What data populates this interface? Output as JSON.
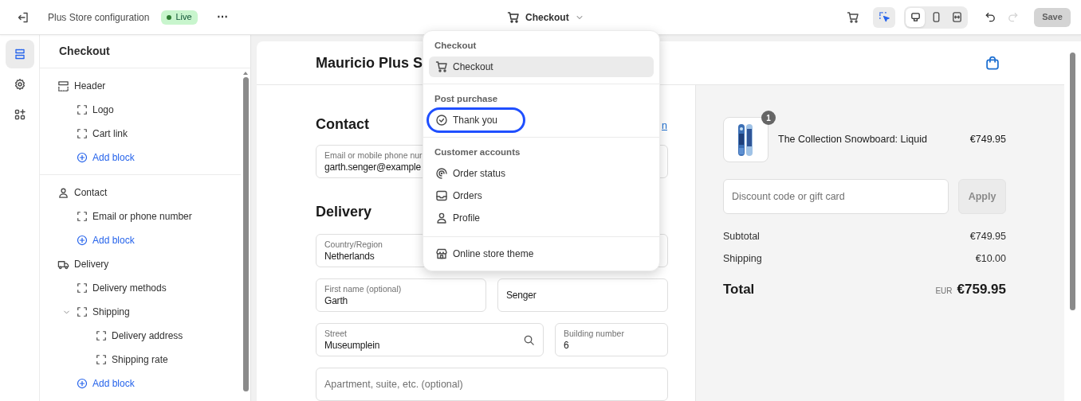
{
  "topbar": {
    "title": "Plus Store configuration",
    "status": {
      "label": "Live",
      "color": "#2e7d32"
    },
    "more": "⋯",
    "page_switcher": {
      "label": "Checkout",
      "expanded": true
    }
  },
  "toolbar": {
    "inspector_on": true,
    "views": [
      {
        "kind": "desktop",
        "selected": true
      },
      {
        "kind": "mobile",
        "selected": false
      },
      {
        "kind": "fullwidth",
        "selected": false
      }
    ],
    "undo_disabled": false,
    "redo_disabled": true,
    "save": {
      "label": "Save",
      "disabled": true
    }
  },
  "rail": [
    {
      "kind": "sections",
      "selected": true
    },
    {
      "kind": "settings",
      "selected": false
    },
    {
      "kind": "apps",
      "selected": false
    }
  ],
  "sidebar": {
    "title": "Checkout",
    "groups": [
      {
        "sections": [
          {
            "kind": "header",
            "label": "Header",
            "children": [
              {
                "kind": "block",
                "label": "Logo"
              },
              {
                "kind": "block",
                "label": "Cart link"
              },
              {
                "kind": "add",
                "label": "Add block"
              }
            ]
          }
        ]
      },
      {
        "sections": [
          {
            "kind": "contact",
            "label": "Contact",
            "children": [
              {
                "kind": "block",
                "label": "Email or phone number"
              },
              {
                "kind": "add",
                "label": "Add block"
              }
            ]
          },
          {
            "kind": "delivery",
            "label": "Delivery",
            "children": [
              {
                "kind": "block",
                "label": "Delivery methods"
              },
              {
                "kind": "block",
                "label": "Shipping",
                "expanded": true,
                "children": [
                  {
                    "kind": "block",
                    "label": "Delivery address"
                  },
                  {
                    "kind": "block",
                    "label": "Shipping rate"
                  }
                ]
              },
              {
                "kind": "add",
                "label": "Add block"
              }
            ]
          }
        ]
      }
    ]
  },
  "preview": {
    "store_name": "Mauricio Plus S",
    "contact": {
      "heading": "Contact",
      "link": "n",
      "field": {
        "label": "Email or mobile phone nur",
        "value": "garth.senger@example"
      }
    },
    "delivery": {
      "heading": "Delivery",
      "rows": [
        [
          {
            "label": "Country/Region",
            "value": "Netherlands"
          }
        ],
        [
          {
            "label": "First name (optional)",
            "value": "Garth"
          },
          {
            "value": "Senger"
          }
        ],
        [
          {
            "label": "Street",
            "value": "Museumplein",
            "kind": "search"
          },
          {
            "label": "Building number",
            "value": "6"
          }
        ],
        [
          {
            "placeholder": "Apartment, suite, etc. (optional)"
          }
        ]
      ]
    },
    "summary": {
      "product": {
        "name": "The Collection Snowboard: Liquid",
        "price": "€749.95",
        "quantity": "1"
      },
      "discount": {
        "placeholder": "Discount code or gift card",
        "button": "Apply"
      },
      "lines": [
        {
          "label": "Subtotal",
          "value": "€749.95"
        },
        {
          "label": "Shipping",
          "value": "€10.00"
        }
      ],
      "total": {
        "label": "Total",
        "currency": "EUR",
        "value": "€759.95"
      }
    }
  },
  "menu": {
    "groups": [
      {
        "title": "Checkout",
        "items": [
          {
            "kind": "cart",
            "label": "Checkout",
            "selected": true,
            "highlighted": false
          }
        ]
      },
      {
        "title": "Post purchase",
        "items": [
          {
            "kind": "check",
            "label": "Thank you",
            "selected": false,
            "highlighted": true
          }
        ]
      },
      {
        "title": "Customer accounts",
        "items": [
          {
            "kind": "status",
            "label": "Order status",
            "selected": false,
            "highlighted": false
          },
          {
            "kind": "inbox",
            "label": "Orders",
            "selected": false,
            "highlighted": false
          },
          {
            "kind": "person",
            "label": "Profile",
            "selected": false,
            "highlighted": false
          }
        ]
      },
      {
        "items": [
          {
            "kind": "store",
            "label": "Online store theme",
            "selected": false,
            "highlighted": false
          }
        ]
      }
    ]
  }
}
